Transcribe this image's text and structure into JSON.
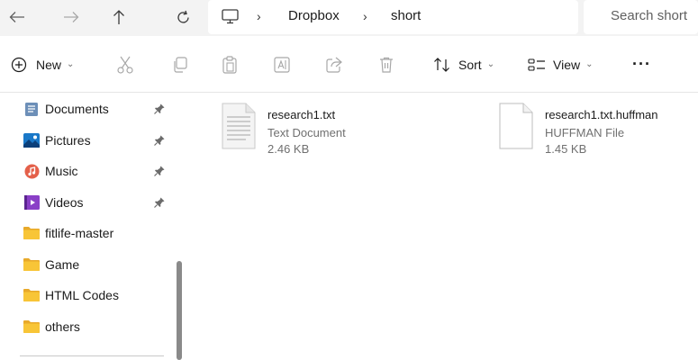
{
  "nav": {
    "back_icon": "arrow-left-icon",
    "forward_icon": "arrow-right-icon",
    "up_icon": "arrow-up-icon",
    "refresh_icon": "refresh-icon"
  },
  "address": {
    "location_icon": "this-pc-icon",
    "crumbs": [
      "Dropbox",
      "short"
    ]
  },
  "search": {
    "placeholder": "Search short"
  },
  "toolbar": {
    "new_label": "New",
    "sort_label": "Sort",
    "view_label": "View",
    "more_label": "···",
    "icons": [
      "cut-icon",
      "copy-icon",
      "paste-icon",
      "rename-icon",
      "share-icon",
      "delete-icon"
    ]
  },
  "sidebar": {
    "items": [
      {
        "label": "Documents",
        "icon": "documents-icon",
        "pinned": true
      },
      {
        "label": "Pictures",
        "icon": "pictures-icon",
        "pinned": true
      },
      {
        "label": "Music",
        "icon": "music-icon",
        "pinned": true
      },
      {
        "label": "Videos",
        "icon": "videos-icon",
        "pinned": true
      },
      {
        "label": "fitlife-master",
        "icon": "folder-icon",
        "pinned": false
      },
      {
        "label": "Game",
        "icon": "folder-icon",
        "pinned": false
      },
      {
        "label": "HTML Codes",
        "icon": "folder-icon",
        "pinned": false
      },
      {
        "label": "others",
        "icon": "folder-icon",
        "pinned": false
      }
    ]
  },
  "files": [
    {
      "name": "research1.txt",
      "type": "Text Document",
      "size": "2.46 KB",
      "icon": "text-document-icon"
    },
    {
      "name": "research1.txt.huffman",
      "type": "HUFFMAN File",
      "size": "1.45 KB",
      "icon": "blank-file-icon"
    }
  ],
  "colors": {
    "accent": "#0067c0",
    "folder": "#f8c537",
    "address_bar_bg": "#f3f3f3"
  }
}
